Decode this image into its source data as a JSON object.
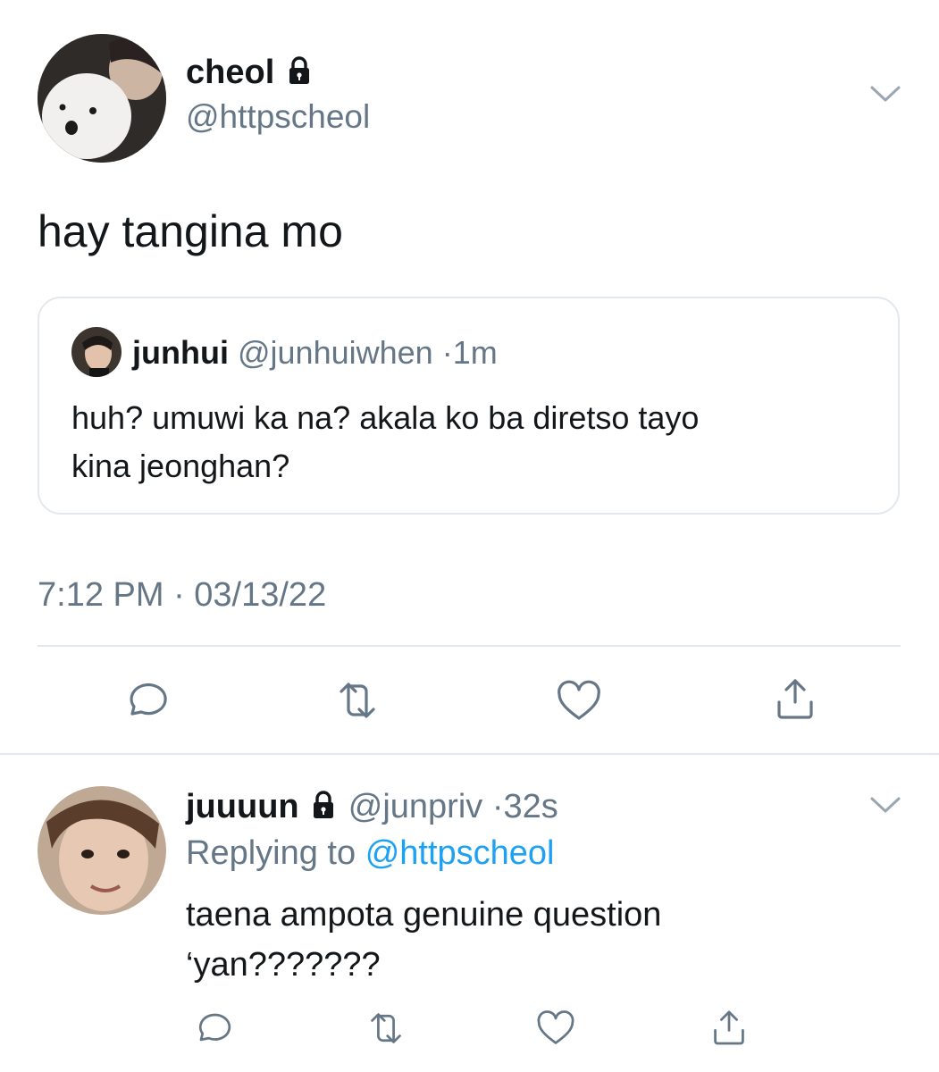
{
  "main_tweet": {
    "display_name": "cheol",
    "handle": "@httpscheol",
    "text": "hay tangina mo",
    "timestamp": "7:12 PM · 03/13/22",
    "quoted": {
      "display_name": "junhui",
      "handle": "@junhuiwhen",
      "time": "1m",
      "line1": "huh? umuwi ka na? akala ko ba diretso tayo",
      "line2": "kina jeonghan?"
    }
  },
  "reply": {
    "display_name": "juuuun",
    "handle": "@junpriv",
    "time": "32s",
    "replying_prefix": "Replying to",
    "replying_to": "@httpscheol",
    "line1": "taena ampota genuine question",
    "line2": "‘yan???????"
  },
  "icons": {
    "lock": "lock-icon",
    "chevron": "chevron-down-icon",
    "reply": "reply-icon",
    "retweet": "retweet-icon",
    "like": "like-icon",
    "share": "share-icon"
  },
  "colors": {
    "text": "#14171a",
    "muted": "#657786",
    "link": "#1da1f2",
    "divider": "#e3e8ec"
  }
}
